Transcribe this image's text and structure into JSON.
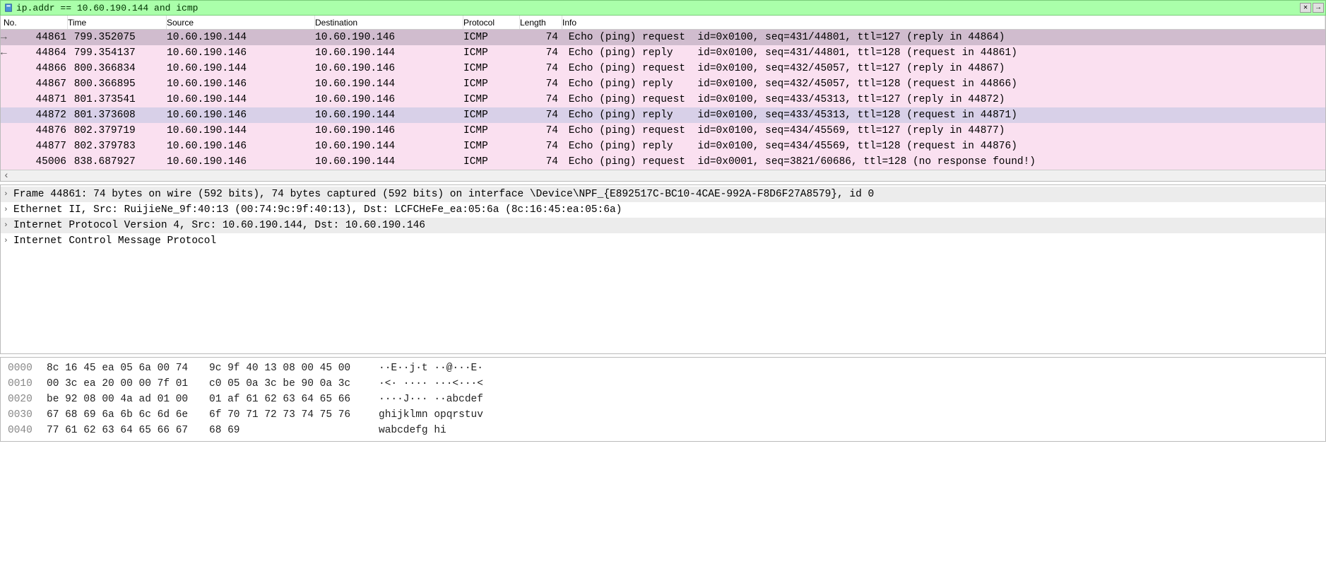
{
  "filter": {
    "text": "ip.addr == 10.60.190.144 and icmp"
  },
  "columns": {
    "no": "No.",
    "time": "Time",
    "source": "Source",
    "destination": "Destination",
    "protocol": "Protocol",
    "length": "Length",
    "info": "Info"
  },
  "packets": [
    {
      "arrow": "→",
      "cls": "row-sel1",
      "no": "44861",
      "time": "799.352075",
      "src": "10.60.190.144",
      "dst": "10.60.190.146",
      "proto": "ICMP",
      "len": "74",
      "info": "Echo (ping) request  id=0x0100, seq=431/44801, ttl=127 (reply in 44864)"
    },
    {
      "arrow": "←",
      "cls": "row-pink",
      "no": "44864",
      "time": "799.354137",
      "src": "10.60.190.146",
      "dst": "10.60.190.144",
      "proto": "ICMP",
      "len": "74",
      "info": "Echo (ping) reply    id=0x0100, seq=431/44801, ttl=128 (request in 44861)"
    },
    {
      "arrow": "",
      "cls": "row-pink",
      "no": "44866",
      "time": "800.366834",
      "src": "10.60.190.144",
      "dst": "10.60.190.146",
      "proto": "ICMP",
      "len": "74",
      "info": "Echo (ping) request  id=0x0100, seq=432/45057, ttl=127 (reply in 44867)"
    },
    {
      "arrow": "",
      "cls": "row-pink",
      "no": "44867",
      "time": "800.366895",
      "src": "10.60.190.146",
      "dst": "10.60.190.144",
      "proto": "ICMP",
      "len": "74",
      "info": "Echo (ping) reply    id=0x0100, seq=432/45057, ttl=128 (request in 44866)"
    },
    {
      "arrow": "",
      "cls": "row-pink",
      "no": "44871",
      "time": "801.373541",
      "src": "10.60.190.144",
      "dst": "10.60.190.146",
      "proto": "ICMP",
      "len": "74",
      "info": "Echo (ping) request  id=0x0100, seq=433/45313, ttl=127 (reply in 44872)"
    },
    {
      "arrow": "",
      "cls": "row-sel2",
      "no": "44872",
      "time": "801.373608",
      "src": "10.60.190.146",
      "dst": "10.60.190.144",
      "proto": "ICMP",
      "len": "74",
      "info": "Echo (ping) reply    id=0x0100, seq=433/45313, ttl=128 (request in 44871)"
    },
    {
      "arrow": "",
      "cls": "row-pink",
      "no": "44876",
      "time": "802.379719",
      "src": "10.60.190.144",
      "dst": "10.60.190.146",
      "proto": "ICMP",
      "len": "74",
      "info": "Echo (ping) request  id=0x0100, seq=434/45569, ttl=127 (reply in 44877)"
    },
    {
      "arrow": "",
      "cls": "row-pink",
      "no": "44877",
      "time": "802.379783",
      "src": "10.60.190.146",
      "dst": "10.60.190.144",
      "proto": "ICMP",
      "len": "74",
      "info": "Echo (ping) reply    id=0x0100, seq=434/45569, ttl=128 (request in 44876)"
    },
    {
      "arrow": "",
      "cls": "row-pink",
      "no": "45006",
      "time": "838.687927",
      "src": "10.60.190.146",
      "dst": "10.60.190.144",
      "proto": "ICMP",
      "len": "74",
      "info": "Echo (ping) request  id=0x0001, seq=3821/60686, ttl=128 (no response found!)"
    }
  ],
  "details": [
    {
      "hl": true,
      "text": "Frame 44861: 74 bytes on wire (592 bits), 74 bytes captured (592 bits) on interface \\Device\\NPF_{E892517C-BC10-4CAE-992A-F8D6F27A8579}, id 0"
    },
    {
      "hl": false,
      "text": "Ethernet II, Src: RuijieNe_9f:40:13 (00:74:9c:9f:40:13), Dst: LCFCHeFe_ea:05:6a (8c:16:45:ea:05:6a)"
    },
    {
      "hl": true,
      "text": "Internet Protocol Version 4, Src: 10.60.190.144, Dst: 10.60.190.146"
    },
    {
      "hl": false,
      "text": "Internet Control Message Protocol"
    }
  ],
  "bytes": [
    {
      "off": "0000",
      "h1": "8c 16 45 ea 05 6a 00 74",
      "h2": "9c 9f 40 13 08 00 45 00",
      "a": "··E··j·t ··@···E·"
    },
    {
      "off": "0010",
      "h1": "00 3c ea 20 00 00 7f 01",
      "h2": "c0 05 0a 3c be 90 0a 3c",
      "a": "·<· ···· ···<···<"
    },
    {
      "off": "0020",
      "h1": "be 92 08 00 4a ad 01 00",
      "h2": "01 af 61 62 63 64 65 66",
      "a": "····J··· ··abcdef"
    },
    {
      "off": "0030",
      "h1": "67 68 69 6a 6b 6c 6d 6e",
      "h2": "6f 70 71 72 73 74 75 76",
      "a": "ghijklmn opqrstuv"
    },
    {
      "off": "0040",
      "h1": "77 61 62 63 64 65 66 67",
      "h2": "68 69",
      "a": "wabcdefg hi"
    }
  ]
}
